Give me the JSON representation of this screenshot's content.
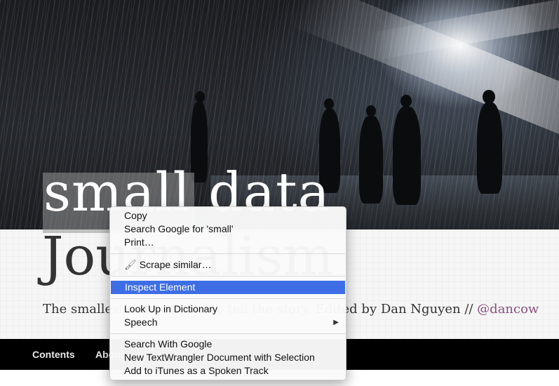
{
  "page": {
    "title_line1": "small data",
    "title_line2": "Journalism",
    "tagline_text": "The smallest data needed to tell the story. Edited by Dan Nguyen // ",
    "tagline_handle": "@dancow"
  },
  "nav": {
    "items": [
      {
        "label": "Contents"
      },
      {
        "label": "About"
      }
    ]
  },
  "context_menu": {
    "items": [
      {
        "label": "Copy"
      },
      {
        "label": "Search Google for 'small'"
      },
      {
        "label": "Print…"
      },
      {
        "label": "Scrape similar…",
        "icon": "brush-icon"
      },
      {
        "label": "Inspect Element",
        "highlighted": true
      },
      {
        "label": "Look Up in Dictionary"
      },
      {
        "label": "Speech",
        "has_submenu": true
      },
      {
        "label": "Search With Google"
      },
      {
        "label": "New TextWrangler Document with Selection"
      },
      {
        "label": "Add to iTunes as a Spoken Track"
      }
    ],
    "submenu_arrow": "▶",
    "brush_glyph": "🖌"
  },
  "colors": {
    "highlight": "#3d6ee6",
    "handle": "#8a4f7d",
    "navbar": "#000000"
  }
}
